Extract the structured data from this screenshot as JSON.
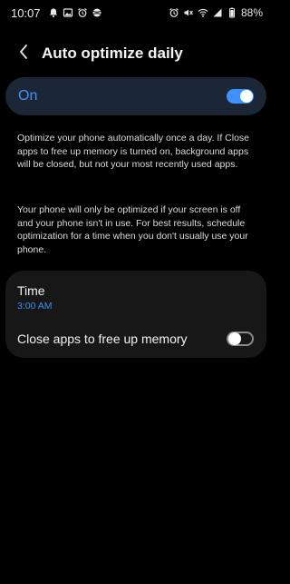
{
  "status_bar": {
    "time": "10:07",
    "battery": "88%",
    "left_icons": [
      "notification-bell-icon",
      "image-icon",
      "alarm-icon",
      "sports-icon"
    ],
    "right_icons": [
      "alarm-icon",
      "mute-icon",
      "wifi-icon",
      "signal-icon",
      "battery-icon"
    ]
  },
  "header": {
    "title": "Auto optimize daily",
    "back_icon": "chevron-left-icon"
  },
  "master_switch": {
    "label": "On",
    "enabled": true,
    "accent_color": "#3e91ff"
  },
  "description": {
    "paragraph_1": "Optimize your phone automatically once a day. If Close apps to free up memory is turned on, background apps will be closed, but not your most recently used apps.",
    "paragraph_2": "Your phone will only be optimized if your screen is off and your phone isn't in use. For best results, schedule optimization for a time when you don't usually use your phone."
  },
  "settings": {
    "time": {
      "title": "Time",
      "value": "3:00 AM"
    },
    "close_apps": {
      "label": "Close apps to free up memory",
      "enabled": false
    }
  }
}
